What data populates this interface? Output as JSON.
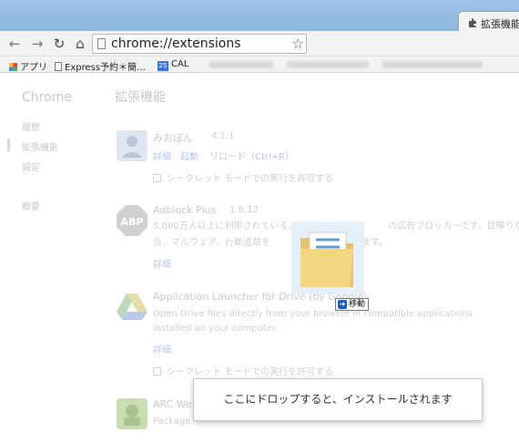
{
  "tab": {
    "title": "拡張機能"
  },
  "toolbar": {
    "url": "chrome://extensions"
  },
  "bookmarks": [
    {
      "label": "アプリ",
      "icon": "apps-icon"
    },
    {
      "label": "Express予約＊簡…",
      "icon": "page-icon"
    },
    {
      "label": "CAL",
      "icon": "calendar-icon",
      "badge": "25"
    }
  ],
  "sidebar": {
    "title": "Chrome",
    "items": [
      "履歴",
      "拡張機能",
      "設定",
      "概要"
    ]
  },
  "main": {
    "title": "拡張機能"
  },
  "extensions": [
    {
      "name": "みおぽん",
      "version": "4.1.1",
      "links": [
        "詳細",
        "起動",
        "リロード（Ctrl+R）"
      ],
      "incognito": "シークレット モードでの実行を許可する"
    },
    {
      "name": "Adblock Plus",
      "version": "1.8.12",
      "desc1": "5,000万人以上に利用されている、",
      "desc1b": "の広告ブロッカーです。目障りな広",
      "desc2": "告、マルウェア、行動追跡を",
      "desc2b": "ます。",
      "links": [
        "詳細"
      ]
    },
    {
      "name": "Application Launcher for Drive (by Google)",
      "desc": "Open Drive files directly from your browser in compatible applications installed on your computer.",
      "links": [
        "詳細"
      ],
      "incognito": "シークレット モードでの実行を許可する"
    },
    {
      "name": "ARC We",
      "desc": "Package"
    }
  ],
  "drag": {
    "move_label": "移動"
  },
  "drop_tooltip": "ここにドロップすると、インストールされます"
}
